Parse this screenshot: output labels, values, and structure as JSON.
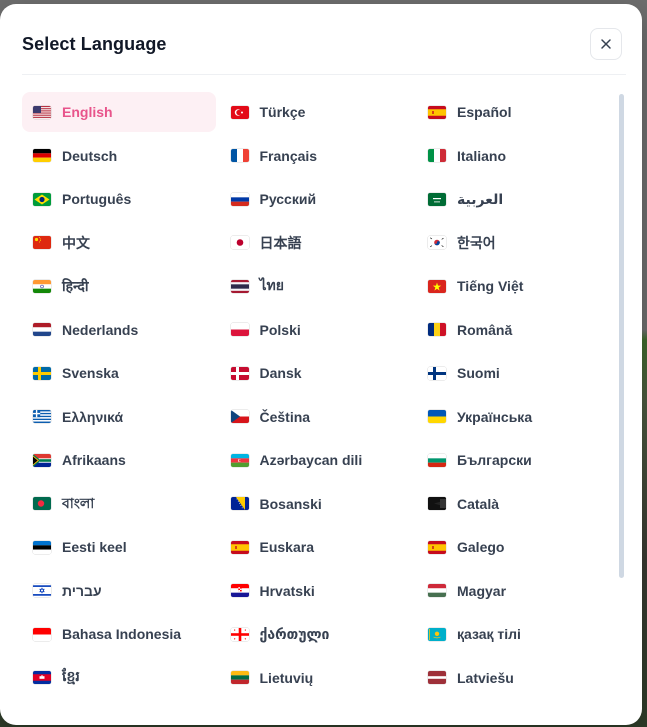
{
  "modal": {
    "title": "Select Language",
    "close_label": "close"
  },
  "languages": [
    {
      "label": "English",
      "flag": "us-flag-icon",
      "active": true
    },
    {
      "label": "Türkçe",
      "flag": "tr-flag-icon"
    },
    {
      "label": "Español",
      "flag": "es-flag-icon"
    },
    {
      "label": "Deutsch",
      "flag": "de-flag-icon"
    },
    {
      "label": "Français",
      "flag": "fr-flag-icon"
    },
    {
      "label": "Italiano",
      "flag": "it-flag-icon"
    },
    {
      "label": "Português",
      "flag": "br-flag-icon"
    },
    {
      "label": "Русский",
      "flag": "ru-flag-icon"
    },
    {
      "label": "العربية",
      "flag": "sa-flag-icon"
    },
    {
      "label": "中文",
      "flag": "cn-flag-icon"
    },
    {
      "label": "日本語",
      "flag": "jp-flag-icon"
    },
    {
      "label": "한국어",
      "flag": "kr-flag-icon"
    },
    {
      "label": "हिन्दी",
      "flag": "in-flag-icon"
    },
    {
      "label": "ไทย",
      "flag": "th-flag-icon"
    },
    {
      "label": "Tiếng Việt",
      "flag": "vn-flag-icon"
    },
    {
      "label": "Nederlands",
      "flag": "nl-flag-icon"
    },
    {
      "label": "Polski",
      "flag": "pl-flag-icon"
    },
    {
      "label": "Română",
      "flag": "ro-flag-icon"
    },
    {
      "label": "Svenska",
      "flag": "se-flag-icon"
    },
    {
      "label": "Dansk",
      "flag": "dk-flag-icon"
    },
    {
      "label": "Suomi",
      "flag": "fi-flag-icon"
    },
    {
      "label": "Ελληνικά",
      "flag": "gr-flag-icon"
    },
    {
      "label": "Čeština",
      "flag": "cz-flag-icon"
    },
    {
      "label": "Українська",
      "flag": "ua-flag-icon"
    },
    {
      "label": "Afrikaans",
      "flag": "za-flag-icon"
    },
    {
      "label": "Azərbaycan dili",
      "flag": "az-flag-icon"
    },
    {
      "label": "Български",
      "flag": "bg-flag-icon"
    },
    {
      "label": "বাংলা",
      "flag": "bd-flag-icon"
    },
    {
      "label": "Bosanski",
      "flag": "ba-flag-icon"
    },
    {
      "label": "Català",
      "flag": "catalonia-flag-icon"
    },
    {
      "label": "Eesti keel",
      "flag": "ee-flag-icon"
    },
    {
      "label": "Euskara",
      "flag": "es-flag-icon"
    },
    {
      "label": "Galego",
      "flag": "es-flag-icon"
    },
    {
      "label": "עברית",
      "flag": "il-flag-icon"
    },
    {
      "label": "Hrvatski",
      "flag": "hr-flag-icon"
    },
    {
      "label": "Magyar",
      "flag": "hu-flag-icon"
    },
    {
      "label": "Bahasa Indonesia",
      "flag": "id-flag-icon"
    },
    {
      "label": "ქართული",
      "flag": "ge-flag-icon"
    },
    {
      "label": "қазақ тілі",
      "flag": "kz-flag-icon"
    },
    {
      "label": "ខ្មែរ",
      "flag": "kh-flag-icon"
    },
    {
      "label": "Lietuvių",
      "flag": "lt-flag-icon"
    },
    {
      "label": "Latviešu",
      "flag": "lv-flag-icon"
    }
  ],
  "colors": {
    "accent": "#e8548b",
    "active_bg": "#fdf0f4",
    "text": "#374151",
    "title": "#111827"
  }
}
